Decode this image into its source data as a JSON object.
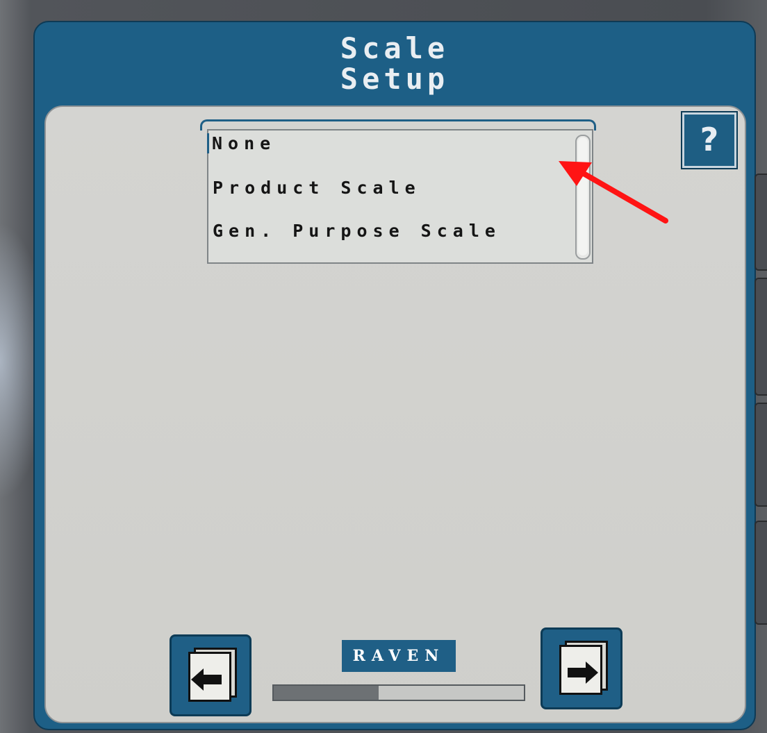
{
  "header": {
    "title_line1": "Scale",
    "title_line2": "Setup"
  },
  "help": {
    "label": "?"
  },
  "scale_type_list": {
    "items": [
      {
        "label": "None",
        "selected": true
      },
      {
        "label": "Product Scale",
        "selected": false
      },
      {
        "label": "Gen. Purpose Scale",
        "selected": false
      }
    ]
  },
  "footer": {
    "brand": "Raven",
    "progress_fraction": 0.42,
    "back_icon": "document-back-arrow-icon",
    "next_icon": "document-next-arrow-icon"
  },
  "colors": {
    "frame_blue": "#1d5f86",
    "panel_gray": "#d2d2cf",
    "annotation_red": "#ff1414"
  }
}
